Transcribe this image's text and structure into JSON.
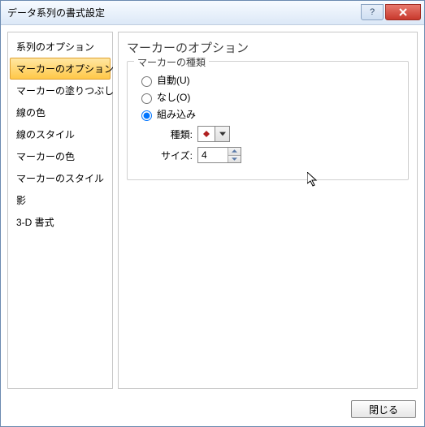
{
  "window": {
    "title": "データ系列の書式設定"
  },
  "sidebar": {
    "items": [
      {
        "label": "系列のオプション"
      },
      {
        "label": "マーカーのオプション"
      },
      {
        "label": "マーカーの塗りつぶし"
      },
      {
        "label": "線の色"
      },
      {
        "label": "線のスタイル"
      },
      {
        "label": "マーカーの色"
      },
      {
        "label": "マーカーのスタイル"
      },
      {
        "label": "影"
      },
      {
        "label": "3-D 書式"
      }
    ],
    "selected_index": 1
  },
  "content": {
    "title": "マーカーのオプション",
    "group_title": "マーカーの種類",
    "radios": {
      "auto": "自動(U)",
      "none": "なし(O)",
      "builtin": "組み込み",
      "selected": "builtin"
    },
    "type_label": "種類:",
    "size_label": "サイズ:",
    "size_value": "4"
  },
  "footer": {
    "close_label": "閉じる"
  }
}
